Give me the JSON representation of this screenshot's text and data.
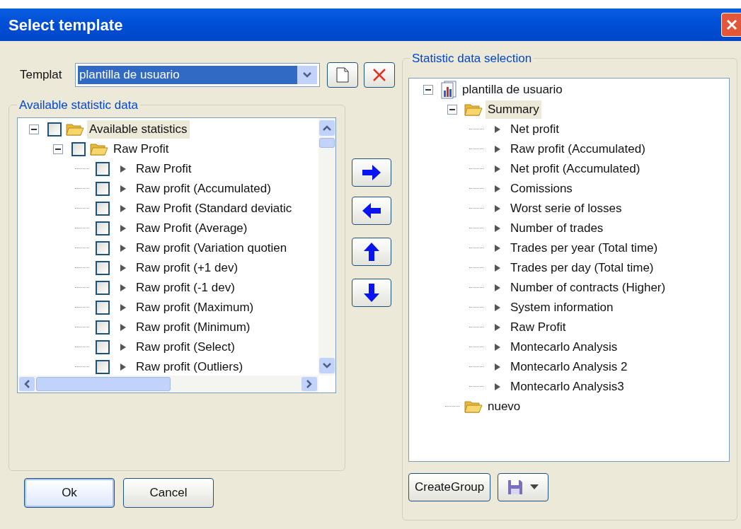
{
  "window": {
    "title": "Select template"
  },
  "template": {
    "label": "Templat",
    "value": "plantilla de usuario"
  },
  "available": {
    "legend": "Available statistic data",
    "tree": [
      {
        "kind": "folder",
        "label": "Available statistics",
        "checked": false,
        "expanded": true,
        "selected": true,
        "children": [
          {
            "kind": "folder",
            "label": "Raw Profit",
            "checked": false,
            "expanded": true,
            "selected": false,
            "children": [
              {
                "kind": "item",
                "label": "Raw Profit",
                "checked": false,
                "selected": false
              },
              {
                "kind": "item",
                "label": "Raw profit (Accumulated)",
                "checked": false,
                "selected": false
              },
              {
                "kind": "item",
                "label": "Raw Profit (Standard deviatic",
                "checked": false,
                "selected": false
              },
              {
                "kind": "item",
                "label": "Raw Profit (Average)",
                "checked": false,
                "selected": false
              },
              {
                "kind": "item",
                "label": "Raw profit (Variation quotien",
                "checked": false,
                "selected": false
              },
              {
                "kind": "item",
                "label": "Raw profit (+1 dev)",
                "checked": false,
                "selected": false
              },
              {
                "kind": "item",
                "label": "Raw profit (-1 dev)",
                "checked": false,
                "selected": false
              },
              {
                "kind": "item",
                "label": "Raw profit (Maximum)",
                "checked": false,
                "selected": false
              },
              {
                "kind": "item",
                "label": "Raw profit (Minimum)",
                "checked": false,
                "selected": false
              },
              {
                "kind": "item",
                "label": "Raw profit (Select)",
                "checked": false,
                "selected": false
              },
              {
                "kind": "item",
                "label": "Raw profit (Outliers)",
                "checked": false,
                "selected": false
              }
            ]
          }
        ]
      }
    ]
  },
  "selection": {
    "legend": "Statistic data selection",
    "tree": [
      {
        "kind": "template",
        "label": "plantilla de usuario",
        "expanded": true,
        "selected": false,
        "children": [
          {
            "kind": "folder",
            "label": "Summary",
            "expanded": true,
            "selected": true,
            "children": [
              {
                "kind": "item",
                "label": "Net profit",
                "selected": false
              },
              {
                "kind": "item",
                "label": "Raw profit (Accumulated)",
                "selected": false
              },
              {
                "kind": "item",
                "label": "Net profit (Accumulated)",
                "selected": false
              },
              {
                "kind": "item",
                "label": "Comissions",
                "selected": false
              },
              {
                "kind": "item",
                "label": "Worst serie of losses",
                "selected": false
              },
              {
                "kind": "item",
                "label": "Number of trades",
                "selected": false
              },
              {
                "kind": "item",
                "label": "Trades per year (Total time)",
                "selected": false
              },
              {
                "kind": "item",
                "label": "Trades per day (Total time)",
                "selected": false
              },
              {
                "kind": "item",
                "label": "Number of contracts (Higher)",
                "selected": false
              },
              {
                "kind": "item",
                "label": "System information",
                "selected": false
              },
              {
                "kind": "item",
                "label": "Raw Profit",
                "selected": false
              },
              {
                "kind": "item",
                "label": "Montecarlo Analysis",
                "selected": false
              },
              {
                "kind": "item",
                "label": "Montecarlo Analysis 2",
                "selected": false
              },
              {
                "kind": "item",
                "label": "Montecarlo Analysis3",
                "selected": false
              }
            ]
          },
          {
            "kind": "folder",
            "label": "nuevo",
            "selected": false
          }
        ]
      }
    ]
  },
  "create_group": "CreateGroup",
  "buttons": [
    "Ok",
    "Cancel"
  ]
}
